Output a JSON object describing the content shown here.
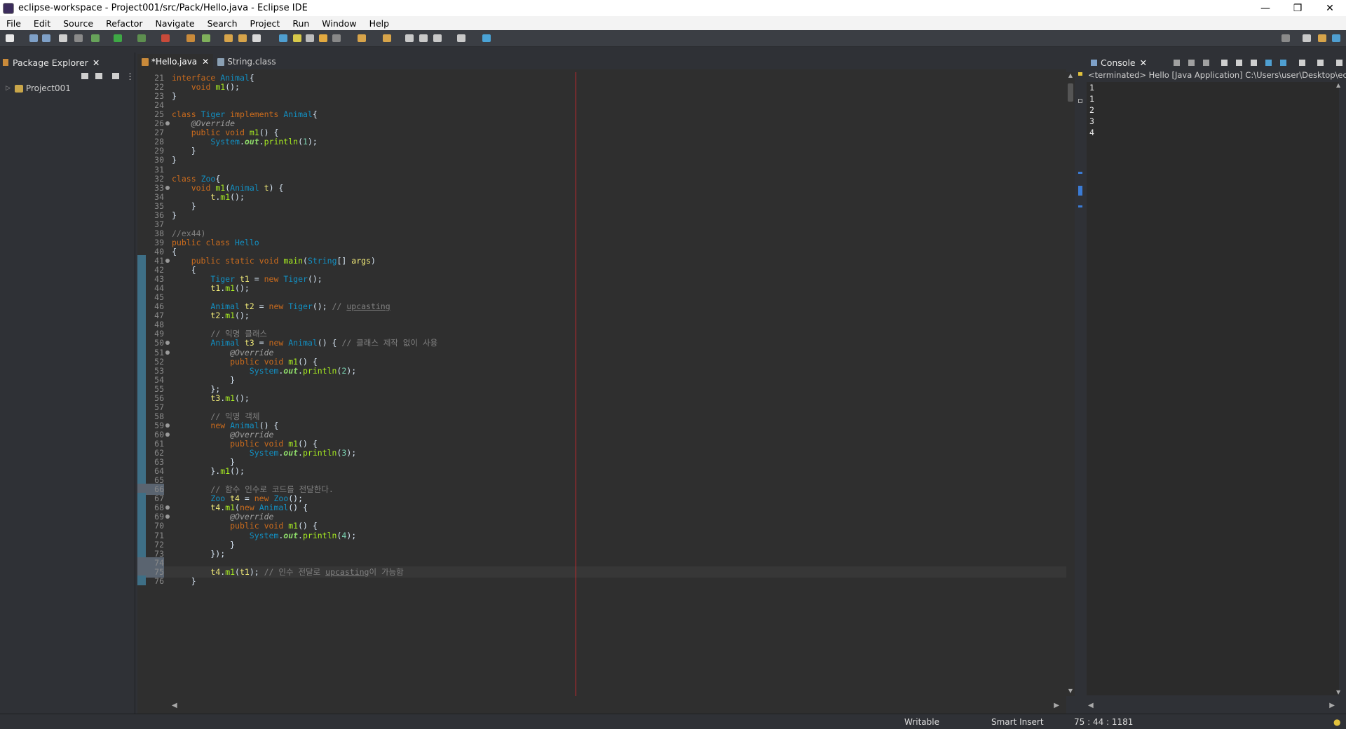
{
  "window": {
    "title": "eclipse-workspace - Project001/src/Pack/Hello.java - Eclipse IDE",
    "controls": [
      "—",
      "❐",
      "✕"
    ]
  },
  "menu": [
    "File",
    "Edit",
    "Source",
    "Refactor",
    "Navigate",
    "Search",
    "Project",
    "Run",
    "Window",
    "Help"
  ],
  "package_explorer": {
    "tab_label": "Package Explorer",
    "tree": [
      {
        "label": "Project001",
        "expanded": false
      }
    ]
  },
  "editor": {
    "tabs": [
      {
        "label": "*Hello.java",
        "active": true
      },
      {
        "label": "String.class",
        "active": false
      }
    ],
    "lines": [
      {
        "n": "21",
        "code": "interface Animal{"
      },
      {
        "n": "22",
        "code": "    void m1();"
      },
      {
        "n": "23",
        "code": "}"
      },
      {
        "n": "24",
        "code": ""
      },
      {
        "n": "25",
        "code": "class Tiger implements Animal{"
      },
      {
        "n": "26",
        "code": "    @Override"
      },
      {
        "n": "27",
        "code": "    public void m1() {"
      },
      {
        "n": "28",
        "code": "        System.out.println(1);"
      },
      {
        "n": "29",
        "code": "    }"
      },
      {
        "n": "30",
        "code": "}"
      },
      {
        "n": "31",
        "code": ""
      },
      {
        "n": "32",
        "code": "class Zoo{"
      },
      {
        "n": "33",
        "code": "    void m1(Animal t) {"
      },
      {
        "n": "34",
        "code": "        t.m1();"
      },
      {
        "n": "35",
        "code": "    }"
      },
      {
        "n": "36",
        "code": "}"
      },
      {
        "n": "37",
        "code": ""
      },
      {
        "n": "38",
        "code": "//ex44)"
      },
      {
        "n": "39",
        "code": "public class Hello"
      },
      {
        "n": "40",
        "code": "{"
      },
      {
        "n": "41",
        "code": "    public static void main(String[] args)"
      },
      {
        "n": "42",
        "code": "    {"
      },
      {
        "n": "43",
        "code": "        Tiger t1 = new Tiger();"
      },
      {
        "n": "44",
        "code": "        t1.m1();"
      },
      {
        "n": "45",
        "code": ""
      },
      {
        "n": "46",
        "code": "        Animal t2 = new Tiger(); // upcasting"
      },
      {
        "n": "47",
        "code": "        t2.m1();"
      },
      {
        "n": "48",
        "code": ""
      },
      {
        "n": "49",
        "code": "        // 익명 클래스"
      },
      {
        "n": "50",
        "code": "        Animal t3 = new Animal() { // 클래스 제작 없이 사용"
      },
      {
        "n": "51",
        "code": "            @Override"
      },
      {
        "n": "52",
        "code": "            public void m1() {"
      },
      {
        "n": "53",
        "code": "                System.out.println(2);"
      },
      {
        "n": "54",
        "code": "            }"
      },
      {
        "n": "55",
        "code": "        };"
      },
      {
        "n": "56",
        "code": "        t3.m1();"
      },
      {
        "n": "57",
        "code": ""
      },
      {
        "n": "58",
        "code": "        // 익명 객체"
      },
      {
        "n": "59",
        "code": "        new Animal() {"
      },
      {
        "n": "60",
        "code": "            @Override"
      },
      {
        "n": "61",
        "code": "            public void m1() {"
      },
      {
        "n": "62",
        "code": "                System.out.println(3);"
      },
      {
        "n": "63",
        "code": "            }"
      },
      {
        "n": "64",
        "code": "        }.m1();"
      },
      {
        "n": "65",
        "code": ""
      },
      {
        "n": "66",
        "code": "        // 함수 인수로 코드를 전달한다."
      },
      {
        "n": "67",
        "code": "        Zoo t4 = new Zoo();"
      },
      {
        "n": "68",
        "code": "        t4.m1(new Animal() {"
      },
      {
        "n": "69",
        "code": "            @Override"
      },
      {
        "n": "70",
        "code": "            public void m1() {"
      },
      {
        "n": "71",
        "code": "                System.out.println(4);"
      },
      {
        "n": "72",
        "code": "            }"
      },
      {
        "n": "73",
        "code": "        });"
      },
      {
        "n": "74",
        "code": ""
      },
      {
        "n": "75",
        "code": "        t4.m1(t1); // 인수 전달로 upcasting이 가능함"
      },
      {
        "n": "76",
        "code": "    }"
      }
    ]
  },
  "console": {
    "tab_label": "Console",
    "header": "<terminated> Hello [Java Application] C:\\Users\\user\\Desktop\\ec",
    "output": [
      "1",
      "1",
      "2",
      "3",
      "4"
    ]
  },
  "status": {
    "writable": "Writable",
    "insert_mode": "Smart Insert",
    "position": "75 : 44 : 1181"
  },
  "colors": {
    "keyword": "#cc6c1d",
    "type": "#1290c3",
    "comment": "#808080",
    "print_margin": "#c8282c"
  }
}
